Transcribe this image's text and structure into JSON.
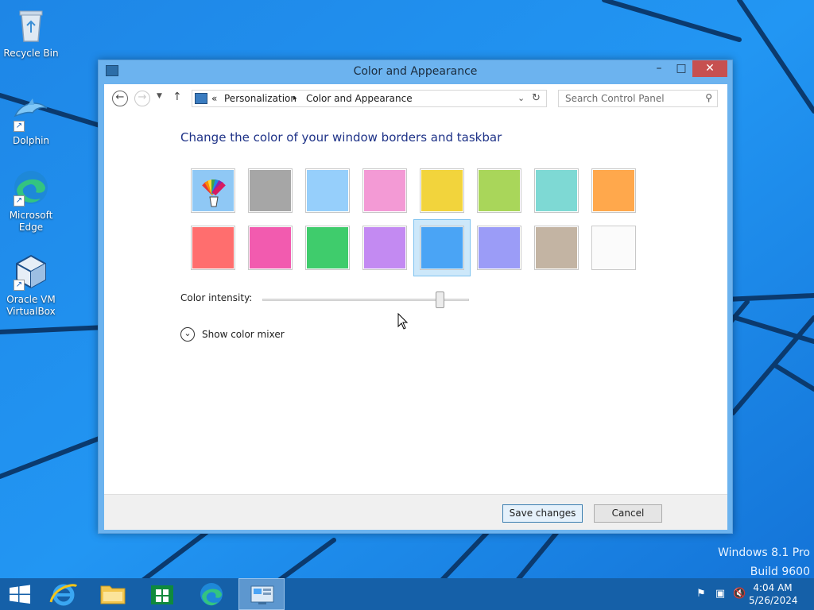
{
  "desktop": {
    "icons": [
      {
        "label": "Recycle Bin",
        "icon": "recycle-bin-icon"
      },
      {
        "label": "Dolphin",
        "icon": "dolphin-icon"
      },
      {
        "label": "Microsoft Edge",
        "icon": "edge-icon"
      },
      {
        "label": "Oracle VM VirtualBox",
        "icon": "virtualbox-icon"
      }
    ],
    "watermark": {
      "line1": "Windows 8.1 Pro",
      "line2": "Build 9600"
    }
  },
  "window": {
    "title": "Color and Appearance",
    "controls": {
      "minimize": "–",
      "maximize": "□",
      "close": "✕"
    },
    "address": {
      "overflow": "«",
      "crumbs": [
        "Personalization",
        "Color and Appearance"
      ],
      "separator": "▸"
    },
    "search": {
      "placeholder": "Search Control Panel"
    },
    "heading": "Change the color of your window borders and taskbar",
    "swatches": [
      {
        "name": "automatic",
        "color": "#8fc8f5",
        "selected": false
      },
      {
        "name": "gray",
        "color": "#a6a6a6",
        "selected": false
      },
      {
        "name": "sky",
        "color": "#96cffb",
        "selected": false
      },
      {
        "name": "pink",
        "color": "#f39ad5",
        "selected": false
      },
      {
        "name": "yellow",
        "color": "#f2d43c",
        "selected": false
      },
      {
        "name": "lime",
        "color": "#a9d65a",
        "selected": false
      },
      {
        "name": "teal",
        "color": "#7ed9d4",
        "selected": false
      },
      {
        "name": "orange",
        "color": "#ffa84c",
        "selected": false
      },
      {
        "name": "red",
        "color": "#ff6e6e",
        "selected": false
      },
      {
        "name": "magenta",
        "color": "#f25baf",
        "selected": false
      },
      {
        "name": "green",
        "color": "#3fcc6c",
        "selected": false
      },
      {
        "name": "violet",
        "color": "#c38af2",
        "selected": false
      },
      {
        "name": "blue",
        "color": "#4aa4f5",
        "selected": true
      },
      {
        "name": "periwinkle",
        "color": "#9b9cf7",
        "selected": false
      },
      {
        "name": "taupe",
        "color": "#c3b4a3",
        "selected": false
      },
      {
        "name": "white",
        "color": "#fbfbfb",
        "selected": false
      }
    ],
    "intensity": {
      "label": "Color intensity:",
      "value": 0.86
    },
    "mixer": {
      "label": "Show color mixer"
    },
    "buttons": {
      "save": "Save changes",
      "cancel": "Cancel"
    }
  },
  "taskbar": {
    "items": [
      {
        "name": "internet-explorer",
        "active": false
      },
      {
        "name": "file-explorer",
        "active": false
      },
      {
        "name": "store",
        "active": false
      },
      {
        "name": "edge",
        "active": false
      },
      {
        "name": "control-panel",
        "active": true
      }
    ],
    "clock": {
      "time": "4:04 AM",
      "date": "5/26/2024"
    }
  }
}
